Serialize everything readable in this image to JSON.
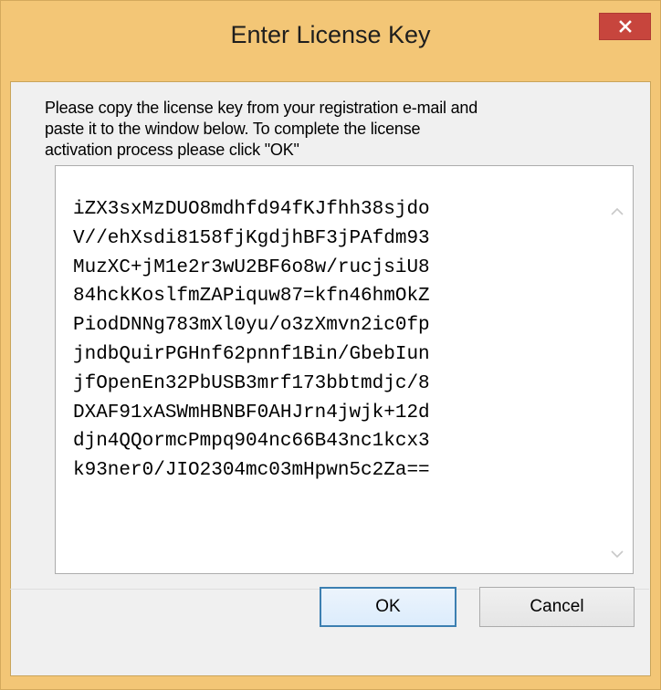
{
  "window": {
    "title": "Enter License Key",
    "close_icon": "close-icon"
  },
  "message": "Please copy the license key from your registration e-mail and\npaste it to the window below. To complete the license\nactivation process please click \"OK\"",
  "license_key": "iZX3sxMzDUO8mdhfd94fKJfhh38sjdo\nV//ehXsdi8158fjKgdjhBF3jPAfdm93\nMuzXC+jM1e2r3wU2BF6o8w/rucjsiU8\n84hckKoslfmZAPiquw87=kfn46hmOkZ\nPiodDNNg783mXl0yu/o3zXmvn2ic0fp\njndbQuirPGHnf62pnnf1Bin/GbebIun\njfOpenEn32PbUSB3mrf173bbtmdjc/8\nDXAF91xASWmHBNBF0AHJrn4jwjk+12d\ndjn4QQormcPmpq904nc66B43nc1kcx3\nk93ner0/JIO2304mc03mHpwn5c2Za==",
  "buttons": {
    "ok": "OK",
    "cancel": "Cancel"
  },
  "colors": {
    "frame": "#f3c676",
    "close_button": "#c7453d",
    "default_button_border": "#3c7fb1"
  }
}
